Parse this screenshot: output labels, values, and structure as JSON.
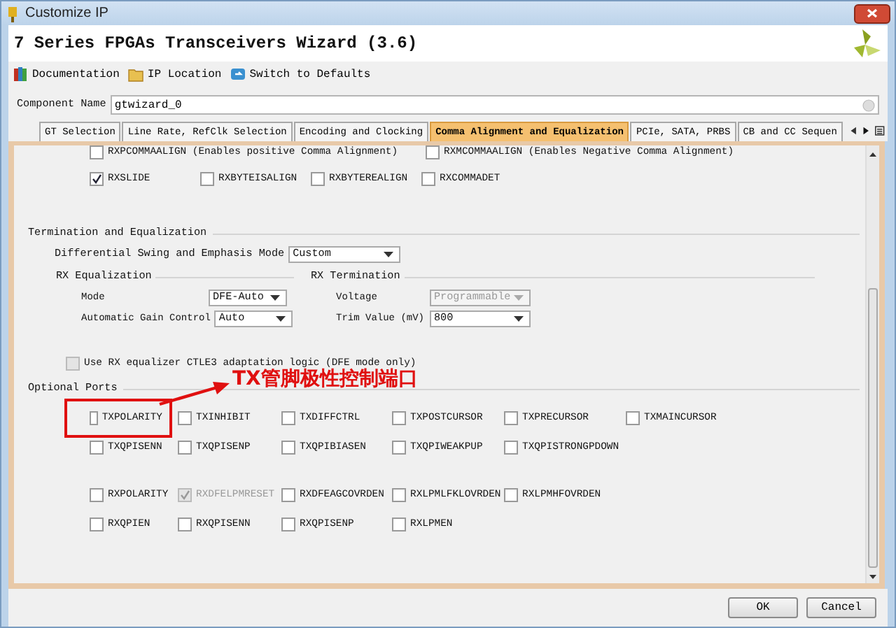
{
  "window": {
    "title": "Customize IP"
  },
  "header": {
    "title": "7 Series FPGAs Transceivers Wizard (3.6)"
  },
  "toolbar": [
    {
      "label": "Documentation",
      "kind": "book"
    },
    {
      "label": "IP Location",
      "kind": "folder"
    },
    {
      "label": "Switch to Defaults",
      "kind": "refresh"
    }
  ],
  "component_name": {
    "label": "Component Name",
    "value": "gtwizard_0"
  },
  "tabs": [
    {
      "label": "GT Selection",
      "selected": false
    },
    {
      "label": "Line Rate, RefClk Selection",
      "selected": false
    },
    {
      "label": "Encoding and Clocking",
      "selected": false
    },
    {
      "label": "Comma Alignment and Equalization",
      "selected": true
    },
    {
      "label": "PCIe, SATA, PRBS",
      "selected": false
    },
    {
      "label": "CB and CC Sequen",
      "selected": false
    }
  ],
  "panel": {
    "comma_options": [
      {
        "label": "RXPCOMMAALIGN (Enables positive Comma Alignment)",
        "checked": false,
        "disabled": false
      },
      {
        "label": "RXMCOMMAALIGN (Enables Negative Comma Alignment)",
        "checked": false,
        "disabled": false
      }
    ],
    "comma_ports": [
      {
        "label": "RXSLIDE",
        "checked": true,
        "disabled": false
      },
      {
        "label": "RXBYTEISALIGN",
        "checked": false,
        "disabled": false
      },
      {
        "label": "RXBYTEREALIGN",
        "checked": false,
        "disabled": false
      },
      {
        "label": "RXCOMMADET",
        "checked": false,
        "disabled": false
      }
    ],
    "termination": {
      "title": "Termination and Equalization",
      "swing_mode": {
        "label": "Differential Swing and Emphasis Mode",
        "value": "Custom",
        "disabled": false
      },
      "rx_equalization": {
        "title": "RX Equalization",
        "fields": [
          {
            "label": "Mode",
            "value": "DFE-Auto",
            "disabled": false
          },
          {
            "label": "Automatic Gain Control",
            "value": "Auto",
            "disabled": false
          }
        ]
      },
      "rx_termination": {
        "title": "RX Termination",
        "fields": [
          {
            "label": "Voltage",
            "value": "Programmable",
            "disabled": true
          },
          {
            "label": "Trim Value (mV)",
            "value": "800",
            "disabled": false
          }
        ]
      },
      "ctle3": {
        "label": "Use RX equalizer CTLE3 adaptation logic (DFE mode only)",
        "checked": false,
        "disabled": true
      }
    },
    "optional_ports": {
      "title": "Optional Ports",
      "groups": [
        [
          [
            {
              "label": "TXPOLARITY",
              "checked": false,
              "disabled": false,
              "highlighted": true
            },
            {
              "label": "TXINHIBIT",
              "checked": false,
              "disabled": false,
              "highlighted": false
            },
            {
              "label": "TXDIFFCTRL",
              "checked": false,
              "disabled": false,
              "highlighted": false
            },
            {
              "label": "TXPOSTCURSOR",
              "checked": false,
              "disabled": false,
              "highlighted": false
            },
            {
              "label": "TXPRECURSOR",
              "checked": false,
              "disabled": false,
              "highlighted": false
            },
            {
              "label": "TXMAINCURSOR",
              "checked": false,
              "disabled": false,
              "highlighted": false
            }
          ],
          [
            {
              "label": "TXQPISENN",
              "checked": false,
              "disabled": false,
              "highlighted": false
            },
            {
              "label": "TXQPISENP",
              "checked": false,
              "disabled": false,
              "highlighted": false
            },
            {
              "label": "TXQPIBIASEN",
              "checked": false,
              "disabled": false,
              "highlighted": false
            },
            {
              "label": "TXQPIWEAKPUP",
              "checked": false,
              "disabled": false,
              "highlighted": false
            },
            {
              "label": "TXQPISTRONGPDOWN",
              "checked": false,
              "disabled": false,
              "highlighted": false
            }
          ]
        ],
        [
          [
            {
              "label": "RXPOLARITY",
              "checked": false,
              "disabled": false,
              "highlighted": false
            },
            {
              "label": "RXDFELPMRESET",
              "checked": true,
              "disabled": true,
              "highlighted": false
            },
            {
              "label": "RXDFEAGCOVRDEN",
              "checked": false,
              "disabled": false,
              "highlighted": false
            },
            {
              "label": "RXLPMLFKLOVRDEN",
              "checked": false,
              "disabled": false,
              "highlighted": false
            },
            {
              "label": "RXLPMHFOVRDEN",
              "checked": false,
              "disabled": false,
              "highlighted": false
            }
          ],
          [
            {
              "label": "RXQPIEN",
              "checked": false,
              "disabled": false,
              "highlighted": false
            },
            {
              "label": "RXQPISENN",
              "checked": false,
              "disabled": false,
              "highlighted": false
            },
            {
              "label": "RXQPISENP",
              "checked": false,
              "disabled": false,
              "highlighted": false
            },
            {
              "label": "RXLPMEN",
              "checked": false,
              "disabled": false,
              "highlighted": false
            }
          ]
        ]
      ]
    }
  },
  "annotation": {
    "text": "TX管脚极性控制端口"
  },
  "buttons": [
    "OK",
    "Cancel"
  ]
}
